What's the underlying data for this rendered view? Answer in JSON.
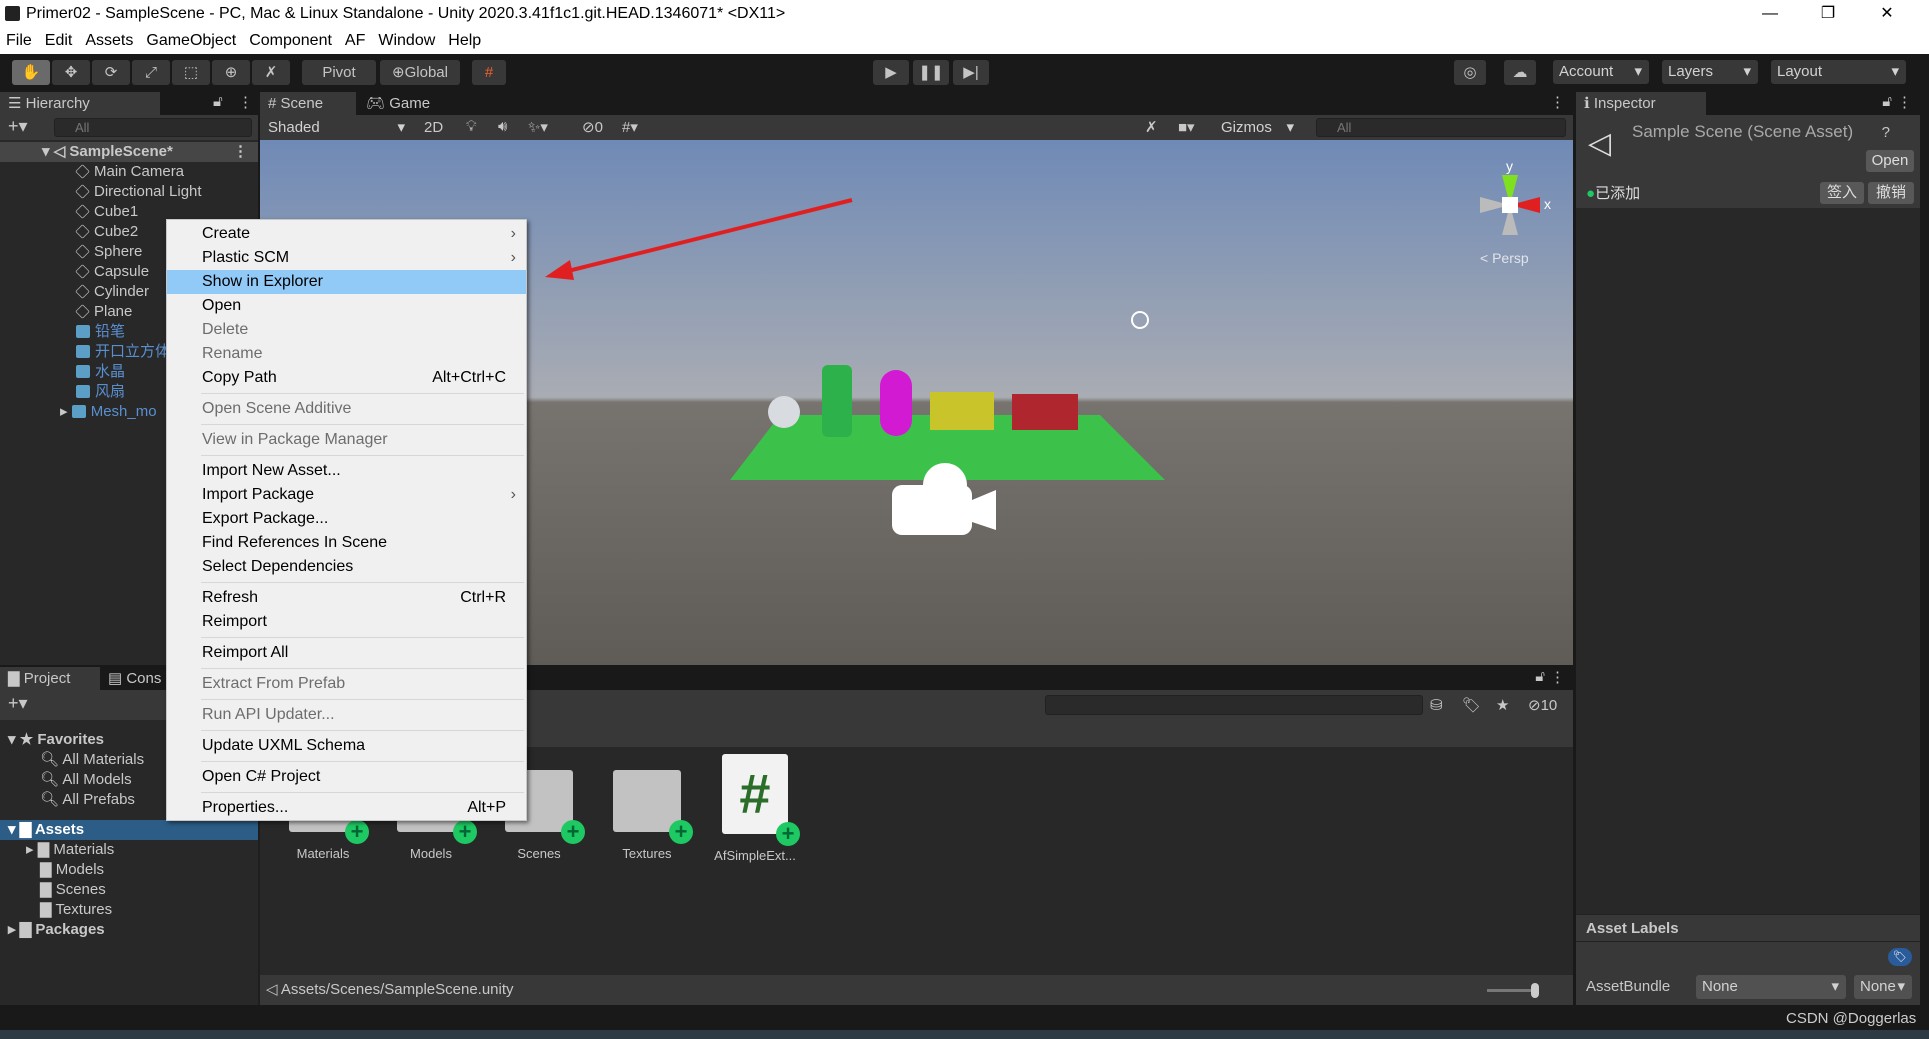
{
  "window": {
    "title": "Primer02 - SampleScene - PC, Mac & Linux Standalone - Unity 2020.3.41f1c1.git.HEAD.1346071* <DX11>"
  },
  "menubar": [
    "File",
    "Edit",
    "Assets",
    "GameObject",
    "Component",
    "AF",
    "Window",
    "Help"
  ],
  "toolbar": {
    "pivot": "Pivot",
    "global": "Global",
    "account": "Account",
    "layers": "Layers",
    "layout": "Layout"
  },
  "hierarchy": {
    "tab": "Hierarchy",
    "search_placeholder": "All",
    "scene": "SampleScene*",
    "items": [
      {
        "label": "Main Camera",
        "prefab": false
      },
      {
        "label": "Directional Light",
        "prefab": false
      },
      {
        "label": "Cube1",
        "prefab": false
      },
      {
        "label": "Cube2",
        "prefab": false
      },
      {
        "label": "Sphere",
        "prefab": false
      },
      {
        "label": "Capsule",
        "prefab": false
      },
      {
        "label": "Cylinder",
        "prefab": false
      },
      {
        "label": "Plane",
        "prefab": false
      },
      {
        "label": "铅笔",
        "prefab": true
      },
      {
        "label": "开口立方体",
        "prefab": true
      },
      {
        "label": "水晶",
        "prefab": true
      },
      {
        "label": "风扇",
        "prefab": true
      },
      {
        "label": "Mesh_mo",
        "prefab": true
      }
    ]
  },
  "scene": {
    "tab_scene": "Scene",
    "tab_game": "Game",
    "shading": "Shaded",
    "mode_2d": "2D",
    "hidden_count": "0",
    "gizmos": "Gizmos",
    "search_placeholder": "All",
    "persp": "Persp",
    "axis_x": "x",
    "axis_y": "y"
  },
  "context_menu": [
    {
      "label": "Create",
      "submenu": true
    },
    {
      "label": "Plastic SCM",
      "submenu": true
    },
    {
      "label": "Show in Explorer",
      "highlighted": true
    },
    {
      "label": "Open"
    },
    {
      "label": "Delete",
      "disabled": true
    },
    {
      "label": "Rename",
      "disabled": true
    },
    {
      "label": "Copy Path",
      "shortcut": "Alt+Ctrl+C"
    },
    {
      "sep": true
    },
    {
      "label": "Open Scene Additive",
      "disabled": true
    },
    {
      "sep": true
    },
    {
      "label": "View in Package Manager",
      "disabled": true
    },
    {
      "sep": true
    },
    {
      "label": "Import New Asset..."
    },
    {
      "label": "Import Package",
      "submenu": true
    },
    {
      "label": "Export Package..."
    },
    {
      "label": "Find References In Scene"
    },
    {
      "label": "Select Dependencies"
    },
    {
      "sep": true
    },
    {
      "label": "Refresh",
      "shortcut": "Ctrl+R"
    },
    {
      "label": "Reimport"
    },
    {
      "sep": true
    },
    {
      "label": "Reimport All"
    },
    {
      "sep": true
    },
    {
      "label": "Extract From Prefab",
      "disabled": true
    },
    {
      "sep": true
    },
    {
      "label": "Run API Updater...",
      "disabled": true
    },
    {
      "sep": true
    },
    {
      "label": "Update UXML Schema"
    },
    {
      "sep": true
    },
    {
      "label": "Open C# Project"
    },
    {
      "sep": true
    },
    {
      "label": "Properties...",
      "shortcut": "Alt+P"
    }
  ],
  "inspector": {
    "tab": "Inspector",
    "title": "Sample Scene (Scene Asset)",
    "open": "Open",
    "vcs_status": "已添加",
    "checkin": "签入",
    "revert": "撤销",
    "asset_labels": "Asset Labels",
    "assetbundle_label": "AssetBundle",
    "assetbundle_value": "None",
    "variant_value": "None"
  },
  "project": {
    "tab": "Project",
    "tab_console": "Cons",
    "hidden_count": "10",
    "favorites": "Favorites",
    "fav_items": [
      "All Materials",
      "All Models",
      "All Prefabs"
    ],
    "assets": "Assets",
    "asset_folders": [
      "Materials",
      "Models",
      "Scenes",
      "Textures"
    ],
    "packages": "Packages",
    "grid_items": [
      {
        "label": "Materials",
        "type": "folder"
      },
      {
        "label": "Models",
        "type": "folder"
      },
      {
        "label": "Scenes",
        "type": "folder"
      },
      {
        "label": "Textures",
        "type": "folder"
      },
      {
        "label": "AfSimpleExt...",
        "type": "script"
      }
    ],
    "path": "Assets/Scenes/SampleScene.unity"
  },
  "watermark": "CSDN @Doggerlas",
  "colors": {
    "accent_selection": "#2c5d87",
    "menu_highlight": "#91c9f7",
    "vcs_added": "#1ec863",
    "arrow": "#e02020"
  }
}
